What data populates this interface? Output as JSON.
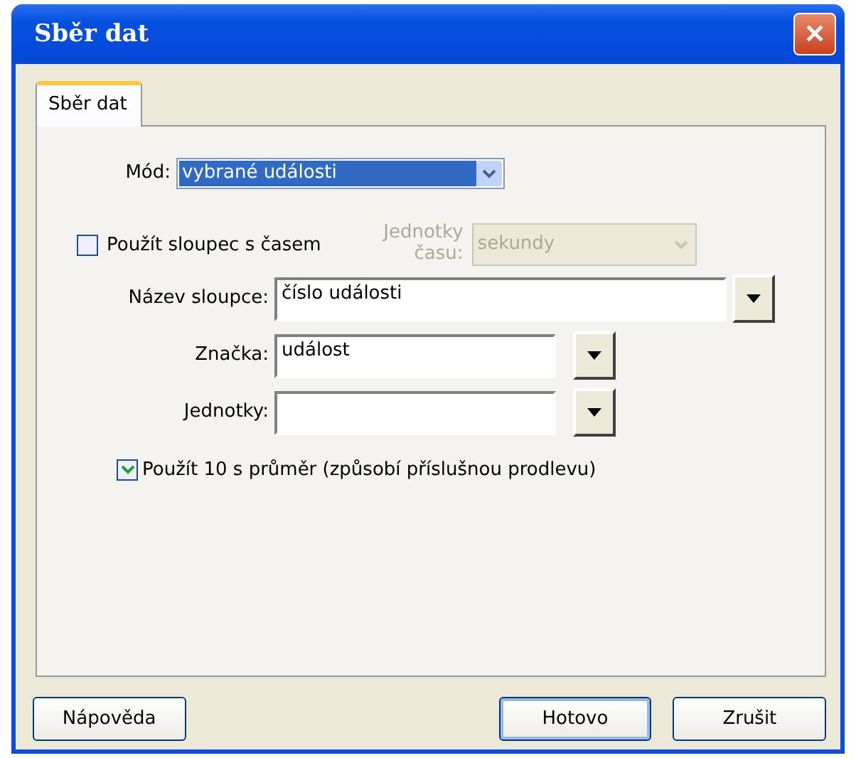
{
  "window": {
    "title": "Sběr dat",
    "close": "✕"
  },
  "tabs": [
    {
      "label": "Sběr dat",
      "selected": true
    }
  ],
  "mode": {
    "label": "Mód:",
    "value": "vybrané události",
    "focused": true
  },
  "time_column": {
    "label": "Použít sloupec s časem",
    "checked": false
  },
  "time_units": {
    "label": "Jednotky času:",
    "value": "sekundy",
    "disabled": true
  },
  "fields": [
    {
      "label": "Název sloupce:",
      "value": "číslo události",
      "wide": true
    },
    {
      "label": "Značka:",
      "value": "událost",
      "wide": false
    },
    {
      "label": "Jednotky:",
      "wide": false
    }
  ],
  "averaging": {
    "label": "Použít 10 s průměr (způsobí příslušnou prodlevu)",
    "checked": true
  },
  "buttons": [
    {
      "label": "Nápověda",
      "default": false
    },
    {
      "label": "Hotovo",
      "default": true
    },
    {
      "label": "Zrušit",
      "default": false
    }
  ]
}
